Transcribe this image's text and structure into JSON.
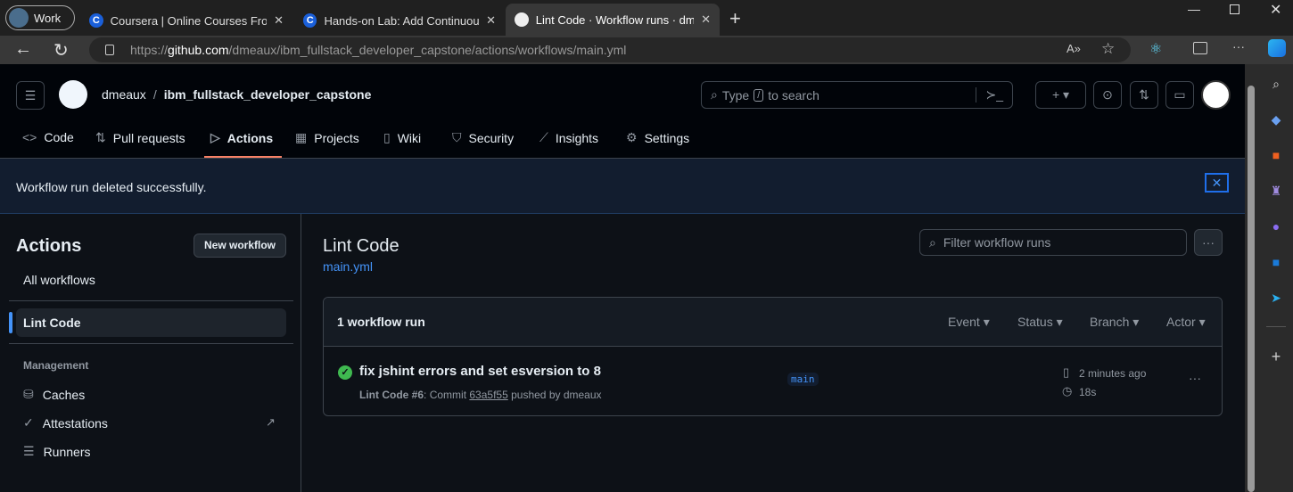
{
  "browser": {
    "profile": "Work",
    "tabs": [
      {
        "title": "Coursera | Online Courses From T"
      },
      {
        "title": "Hands-on Lab: Add Continuous I"
      },
      {
        "title": "Lint Code · Workflow runs · dmea",
        "active": true
      }
    ],
    "url_prefix": "https://",
    "url_domain": "github.com",
    "url_path": "/dmeaux/ibm_fullstack_developer_capstone/actions/workflows/main.yml"
  },
  "header": {
    "owner": "dmeaux",
    "separator": "/",
    "repo": "ibm_fullstack_developer_capstone",
    "search_pre": "Type",
    "search_key": "/",
    "search_post": "to search"
  },
  "repo_nav": [
    {
      "label": "Code",
      "icon": "code-icon"
    },
    {
      "label": "Pull requests",
      "icon": "git-pull-request-icon"
    },
    {
      "label": "Actions",
      "icon": "play-icon",
      "active": true
    },
    {
      "label": "Projects",
      "icon": "table-icon"
    },
    {
      "label": "Wiki",
      "icon": "book-icon"
    },
    {
      "label": "Security",
      "icon": "shield-icon"
    },
    {
      "label": "Insights",
      "icon": "graph-icon"
    },
    {
      "label": "Settings",
      "icon": "gear-icon"
    }
  ],
  "flash": {
    "message": "Workflow run deleted successfully."
  },
  "sidebar": {
    "title": "Actions",
    "new_workflow": "New workflow",
    "all_workflows": "All workflows",
    "selected": "Lint Code",
    "management_heading": "Management",
    "management": [
      {
        "label": "Caches"
      },
      {
        "label": "Attestations"
      },
      {
        "label": "Runners"
      }
    ]
  },
  "main": {
    "title": "Lint Code",
    "file": "main.yml",
    "filter_placeholder": "Filter workflow runs",
    "count": "1 workflow run",
    "filters": [
      "Event",
      "Status",
      "Branch",
      "Actor"
    ],
    "runs": [
      {
        "title": "fix jshint errors and set esversion to 8",
        "workflow": "Lint Code",
        "number": "#6",
        "commit_label": ": Commit",
        "sha": "63a5f55",
        "pushed_by": "pushed by dmeaux",
        "branch": "main",
        "time": "2 minutes ago",
        "duration": "18s",
        "status": "success"
      }
    ]
  },
  "colors": {
    "accent": "#4493f8",
    "success": "#3fb950",
    "active_tab_underline": "#f78166"
  }
}
